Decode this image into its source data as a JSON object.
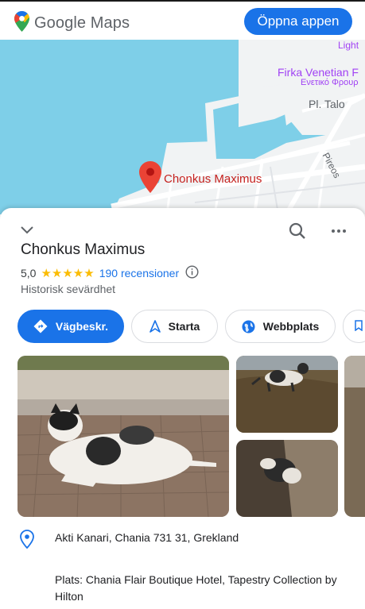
{
  "header": {
    "logo_text": "Google Maps",
    "open_app_label": "Öppna appen"
  },
  "map": {
    "labels": {
      "firka": "Firka Venetian F",
      "firka_greek": "Ενετικό Φρουρ",
      "lighthouse": "Light",
      "pl_talo": "Pl. Talo",
      "pireos": "Pireos",
      "pin_label": "Chonkus Maximus"
    },
    "colors": {
      "water": "#7ecfe8",
      "land": "#f1f3f4",
      "road": "#ffffff",
      "pin": "#ea4335"
    }
  },
  "place": {
    "title": "Chonkus Maximus",
    "rating": "5,0",
    "stars": "★★★★★",
    "reviews": "190 recensioner",
    "category": "Historisk sevärdhet"
  },
  "actions": {
    "directions": "Vägbeskr.",
    "start": "Starta",
    "website": "Webbplats"
  },
  "details": {
    "address": "Akti Kanari, Chania 731 31, Grekland",
    "plus_location": "Plats: Chania Flair Boutique Hotel, Tapestry Collection by Hilton"
  },
  "icons": [
    "maps-pin-logo-icon",
    "map-pin-icon",
    "chevron-down-icon",
    "search-icon",
    "more-icon",
    "info-icon",
    "directions-icon",
    "navigation-arrow-icon",
    "globe-icon",
    "location-pin-icon"
  ]
}
